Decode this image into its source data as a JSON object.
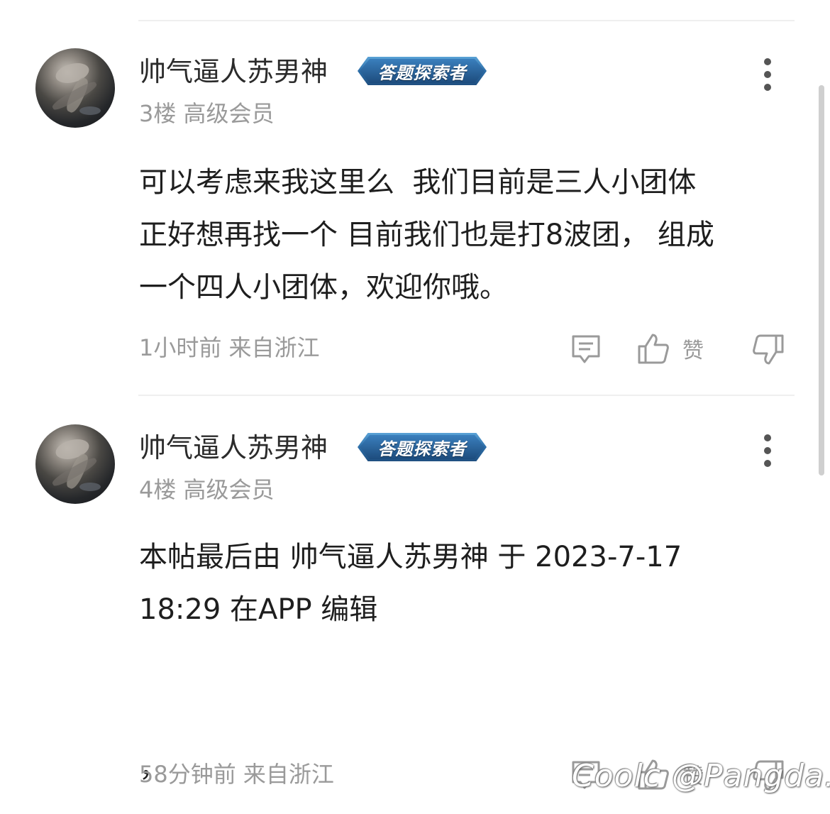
{
  "posts": [
    {
      "username": "帅气逼人苏男神",
      "badge": "答题探索者",
      "floor": "3楼",
      "level": "高级会员",
      "content": "可以考虑来我这里么  我们目前是三人小团体\n正好想再找一个 目前我们也是打8波团， 组成\n一个四人小团体，欢迎你哦。",
      "time": "1小时前",
      "location": "来自浙江",
      "like_label": "赞"
    },
    {
      "username": "帅气逼人苏男神",
      "badge": "答题探索者",
      "floor": "4楼",
      "level": "高级会员",
      "content": "本帖最后由 帅气逼人苏男神 于 2023-7-17\n18:29 在APP 编辑\n\n\n，",
      "time": "58分钟前",
      "location": "来自浙江",
      "like_label": "赞"
    }
  ],
  "watermark": "Coolc @Pangda.",
  "icons": {
    "more": "more-vertical-icon",
    "comment": "comment-icon",
    "like": "thumbs-up-icon",
    "dislike": "thumbs-down-icon"
  }
}
